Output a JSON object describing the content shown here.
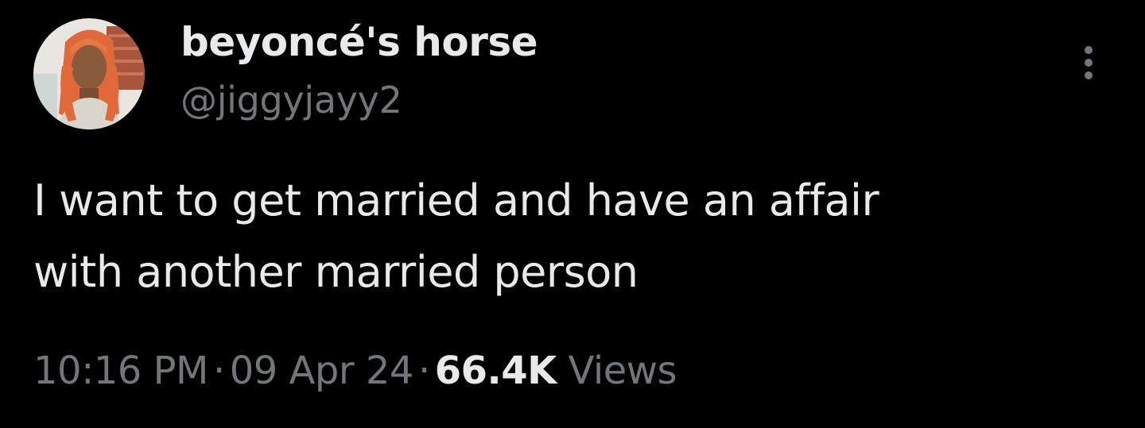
{
  "author": {
    "display_name": "beyoncé's horse",
    "handle": "@jiggyjayy2",
    "avatar_icon": "profile-photo"
  },
  "tweet": {
    "text": "I want to get married and have an affair\nwith another married person"
  },
  "meta": {
    "time": "10:16 PM",
    "separator": "·",
    "date": "09 Apr 24",
    "views_count": "66.4K",
    "views_label": "Views"
  },
  "actions": {
    "more_icon": "more-vertical-icon"
  },
  "colors": {
    "background": "#000000",
    "primary_text": "#e7e9ea",
    "secondary_text": "#71767b"
  }
}
